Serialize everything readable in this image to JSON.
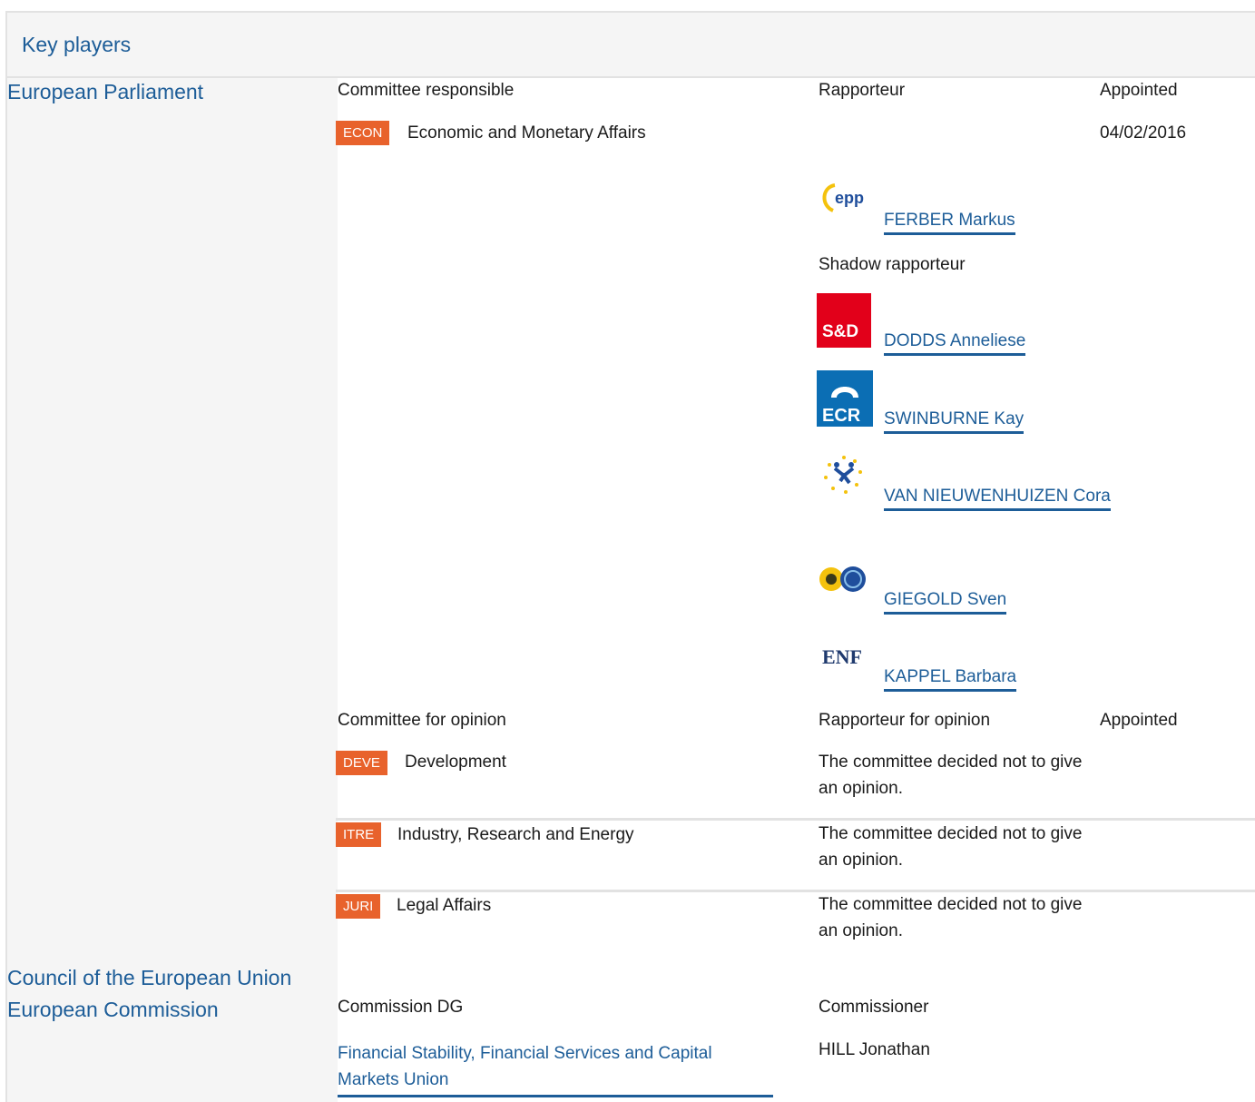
{
  "header": {
    "title": "Key players"
  },
  "institutions": {
    "parliament": "European Parliament",
    "council": "Council of the European Union",
    "commission": "European Commission"
  },
  "responsible": {
    "col_committee": "Committee responsible",
    "col_rapporteur": "Rapporteur",
    "col_appointed": "Appointed",
    "badge": "ECON",
    "committee": "Economic and Monetary Affairs",
    "date": "04/02/2016",
    "rapporteur": {
      "group": "EPP",
      "name": "FERBER Markus"
    },
    "shadow_label": "Shadow rapporteur",
    "shadows": [
      {
        "group": "S&D",
        "name": "DODDS Anneliese"
      },
      {
        "group": "ECR",
        "name": "SWINBURNE Kay"
      },
      {
        "group": "ALDE",
        "name": "VAN NIEUWENHUIZEN Cora"
      },
      {
        "group": "Greens/EFA",
        "name": "GIEGOLD Sven"
      },
      {
        "group": "ENF",
        "name": "KAPPEL Barbara"
      }
    ]
  },
  "opinion": {
    "col_committee": "Committee for opinion",
    "col_rapporteur": "Rapporteur for opinion",
    "col_appointed": "Appointed",
    "rows": [
      {
        "badge": "DEVE",
        "name": "Development",
        "note": "The committee decided not to give an opinion."
      },
      {
        "badge": "ITRE",
        "name": "Industry, Research and Energy",
        "note": "The committee decided not to give an opinion."
      },
      {
        "badge": "JURI",
        "name": "Legal Affairs",
        "note": "The committee decided not to give an opinion."
      }
    ]
  },
  "commission": {
    "col_dg": "Commission DG",
    "col_commissioner": "Commissioner",
    "dg": "Financial Stability, Financial Services and Capital Markets Union",
    "commissioner": "HILL Jonathan"
  },
  "colors": {
    "badge": "#e8622c",
    "link": "#1d5d98",
    "panel": "#f5f5f5",
    "border": "#e2e2e2"
  }
}
